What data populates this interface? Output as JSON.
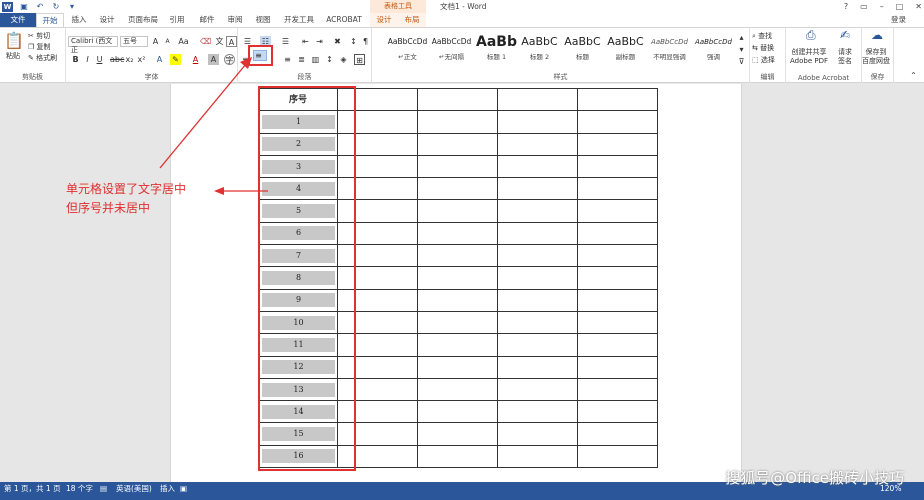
{
  "app": {
    "document_title": "文档1 - Word",
    "context_tools_label": "表格工具",
    "login": "登录"
  },
  "window_controls": [
    "?",
    "▭",
    "–",
    "□",
    "✕"
  ],
  "tabs": [
    "文件",
    "开始",
    "插入",
    "设计",
    "页面布局",
    "引用",
    "邮件",
    "审阅",
    "视图",
    "开发工具",
    "ACROBAT",
    "设计",
    "布局"
  ],
  "clipboard": {
    "paste": "粘贴",
    "cut": "剪切",
    "copy": "复制",
    "format_painter": "格式刷",
    "group_label": "剪贴板"
  },
  "font": {
    "name": "Calibri (西文正",
    "size": "五号",
    "group_label": "字体"
  },
  "paragraph": {
    "group_label": "段落"
  },
  "styles": {
    "items": [
      {
        "sample": "AaBbCcDd",
        "name": "↵正文"
      },
      {
        "sample": "AaBbCcDd",
        "name": "↵无间隔"
      },
      {
        "sample": "AaBb",
        "name": "标题 1"
      },
      {
        "sample": "AaBbC",
        "name": "标题 2"
      },
      {
        "sample": "AaBbC",
        "name": "标题"
      },
      {
        "sample": "AaBbC",
        "name": "副标题"
      },
      {
        "sample": "AaBbCcDd",
        "name": "不明显强调"
      },
      {
        "sample": "AaBbCcDd",
        "name": "强调"
      }
    ],
    "group_label": "样式"
  },
  "editing": {
    "find": "查找",
    "replace": "替换",
    "select": "选择",
    "group_label": "编辑"
  },
  "acrobat": {
    "create_share_line1": "创建并共享",
    "create_share_line2": "Adobe PDF",
    "request_sign_line1": "请求",
    "request_sign_line2": "签名",
    "group_label": "Adobe Acrobat"
  },
  "save": {
    "line1": "保存到",
    "line2": "百度网盘",
    "group_label": "保存"
  },
  "table": {
    "header": "序号",
    "numbers": [
      "1",
      "2",
      "3",
      "4",
      "5",
      "6",
      "7",
      "8",
      "9",
      "10",
      "11",
      "12",
      "13",
      "14",
      "15",
      "16"
    ]
  },
  "annotation": {
    "line1": "单元格设置了文字居中",
    "line2": "但序号并未居中"
  },
  "statusbar": {
    "page": "第 1 页，共 1 页",
    "words": "18 个字",
    "lang": "英语(美国)",
    "mode": "插入",
    "zoom": "120%"
  },
  "watermark": "搜狐号@Office搬砖小技巧",
  "colors": {
    "accent": "#2b579a",
    "annotation": "#e03030",
    "cell_shade": "#c8c8c8"
  }
}
